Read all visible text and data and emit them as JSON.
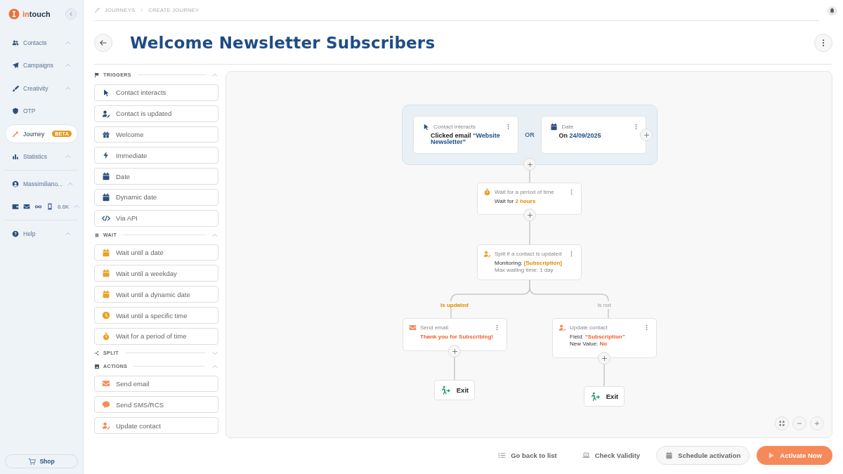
{
  "sidebar": {
    "logo": [
      "in",
      "touch"
    ],
    "nav": [
      {
        "kind": "contacts",
        "label": "Contacts",
        "selected": false,
        "has_submenu": true
      },
      {
        "kind": "campaigns",
        "label": "Campaigns",
        "selected": false,
        "has_submenu": true
      },
      {
        "kind": "creativity",
        "label": "Creativity",
        "selected": false,
        "has_submenu": true
      },
      {
        "kind": "otp",
        "label": "OTP",
        "selected": false,
        "has_submenu": false
      },
      {
        "kind": "journey",
        "label": "Journey",
        "selected": true,
        "has_submenu": false,
        "badge": "BETA"
      },
      {
        "kind": "statistics",
        "label": "Statistics",
        "selected": false,
        "has_submenu": true
      }
    ],
    "account": [
      {
        "kind": "user",
        "label": "Massimiliano...",
        "has_submenu": true
      },
      {
        "kind": "credits",
        "label": "6.6K",
        "has_submenu": true
      }
    ],
    "help": {
      "label": "Help",
      "has_submenu": true
    },
    "shop_button": "Shop"
  },
  "breadcrumb": [
    "JOURNEYS",
    "CREATE JOURNEY"
  ],
  "title": "Welcome Newsletter Subscribers",
  "palette": [
    {
      "kind": "triggers",
      "title": "TRIGGERS",
      "expanded": true,
      "items": [
        {
          "kind": "interaction",
          "label": "Contact interacts"
        },
        {
          "kind": "update",
          "label": "Contact is updated"
        },
        {
          "kind": "welcome",
          "label": "Welcome"
        },
        {
          "kind": "immediate",
          "label": "Immediate"
        },
        {
          "kind": "date",
          "label": "Date"
        },
        {
          "kind": "dynamic-date",
          "label": "Dynamic date"
        },
        {
          "kind": "api",
          "label": "Via API"
        }
      ]
    },
    {
      "kind": "wait",
      "title": "WAIT",
      "expanded": true,
      "items": [
        {
          "kind": "wait-date",
          "label": "Wait until a date"
        },
        {
          "kind": "wait-weekday",
          "label": "Wait until a weekday"
        },
        {
          "kind": "wait-dynamic",
          "label": "Wait until a dynamic date"
        },
        {
          "kind": "wait-time",
          "label": "Wait until a specific time"
        },
        {
          "kind": "wait-period",
          "label": "Wait for a period of time"
        }
      ]
    },
    {
      "kind": "split",
      "title": "SPLIT",
      "expanded": false
    },
    {
      "kind": "actions",
      "title": "ACTIONS",
      "expanded": true,
      "items": [
        {
          "kind": "email",
          "label": "Send email"
        },
        {
          "kind": "sms",
          "label": "Send SMS/RCS"
        },
        {
          "kind": "update-contact",
          "label": "Update contact"
        }
      ]
    }
  ],
  "flow": {
    "triggers": {
      "joiner": "OR",
      "cards": [
        {
          "kind": "interaction",
          "label": "Contact interacts",
          "lines": [
            {
              "text": "Clicked email",
              "value": "“Website Newsletter”"
            }
          ]
        },
        {
          "kind": "date",
          "label": "Date",
          "lines": [
            {
              "text": "On",
              "value": "24/09/2025"
            }
          ]
        }
      ]
    },
    "steps": [
      {
        "kind": "wait",
        "label": "Wait for a period of time",
        "lines": [
          {
            "text": "Wait for",
            "value": "2 hours"
          }
        ]
      },
      {
        "kind": "split",
        "label": "Split if a contact is updated",
        "lines": [
          {
            "text": "Monitoring:",
            "value": "[Subscription]"
          },
          {
            "text": "Max waiting time: 1 day",
            "note": true
          }
        ]
      }
    ],
    "branches": [
      {
        "label": "Is updated",
        "highlighted": true,
        "exit": "Exit",
        "node": {
          "kind": "email",
          "label": "Send email",
          "lines": [
            {
              "value": "Thank you for Subscribing!"
            }
          ]
        }
      },
      {
        "label": "Is not",
        "highlighted": false,
        "exit": "Exit",
        "node": {
          "kind": "update",
          "label": "Update contact",
          "lines": [
            {
              "text": "Field:",
              "value": "“Subscription”"
            },
            {
              "text": "New Value:",
              "value": "No"
            }
          ]
        }
      }
    ]
  },
  "footer": [
    {
      "kind": "list",
      "label": "Go back to list"
    },
    {
      "kind": "validate",
      "label": "Check Validity"
    },
    {
      "kind": "schedule",
      "label": "Schedule activation"
    },
    {
      "kind": "activate",
      "label": "Activate Now"
    }
  ]
}
